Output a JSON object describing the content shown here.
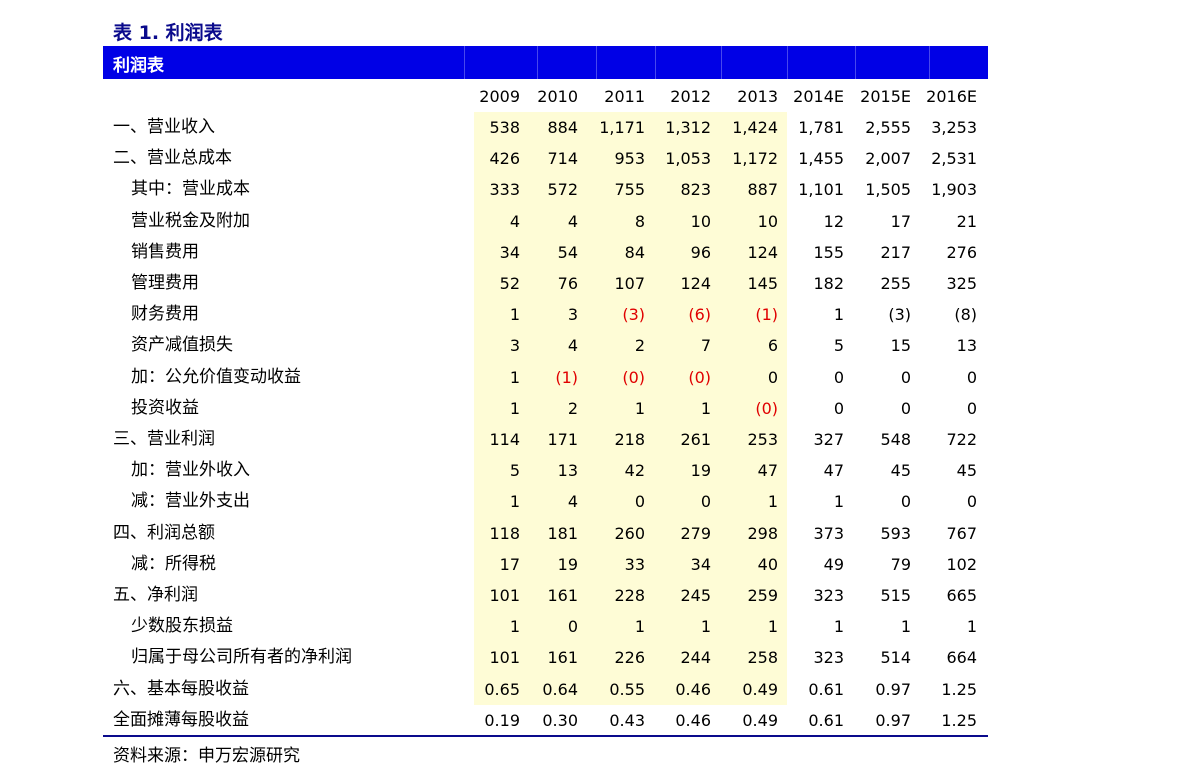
{
  "caption": "表 1. 利润表",
  "header": {
    "title": "利润表"
  },
  "years": [
    "2009",
    "2010",
    "2011",
    "2012",
    "2013",
    "2014E",
    "2015E",
    "2016E"
  ],
  "rows": [
    {
      "label": "一、营业收入",
      "indent": 0,
      "values": [
        "538",
        "884",
        "1,171",
        "1,312",
        "1,424",
        "1,781",
        "2,555",
        "3,253"
      ]
    },
    {
      "label": "二、营业总成本",
      "indent": 0,
      "values": [
        "426",
        "714",
        "953",
        "1,053",
        "1,172",
        "1,455",
        "2,007",
        "2,531"
      ]
    },
    {
      "label": "其中：营业成本",
      "indent": 1,
      "values": [
        "333",
        "572",
        "755",
        "823",
        "887",
        "1,101",
        "1,505",
        "1,903"
      ]
    },
    {
      "label": "营业税金及附加",
      "indent": 1,
      "values": [
        "4",
        "4",
        "8",
        "10",
        "10",
        "12",
        "17",
        "21"
      ]
    },
    {
      "label": "销售费用",
      "indent": 1,
      "values": [
        "34",
        "54",
        "84",
        "96",
        "124",
        "155",
        "217",
        "276"
      ]
    },
    {
      "label": "管理费用",
      "indent": 1,
      "values": [
        "52",
        "76",
        "107",
        "124",
        "145",
        "182",
        "255",
        "325"
      ]
    },
    {
      "label": "财务费用",
      "indent": 1,
      "values": [
        "1",
        "3",
        "(3)",
        "(6)",
        "(1)",
        "1",
        "(3)",
        "(8)"
      ],
      "neg": [
        false,
        false,
        true,
        true,
        true,
        false,
        false,
        false
      ]
    },
    {
      "label": "资产减值损失",
      "indent": 1,
      "values": [
        "3",
        "4",
        "2",
        "7",
        "6",
        "5",
        "15",
        "13"
      ]
    },
    {
      "label": "加：公允价值变动收益",
      "indent": 1,
      "values": [
        "1",
        "(1)",
        "(0)",
        "(0)",
        "0",
        "0",
        "0",
        "0"
      ],
      "neg": [
        false,
        true,
        true,
        true,
        false,
        false,
        false,
        false
      ]
    },
    {
      "label": "投资收益",
      "indent": 1,
      "values": [
        "1",
        "2",
        "1",
        "1",
        "(0)",
        "0",
        "0",
        "0"
      ],
      "neg": [
        false,
        false,
        false,
        false,
        true,
        false,
        false,
        false
      ]
    },
    {
      "label": "三、营业利润",
      "indent": 0,
      "values": [
        "114",
        "171",
        "218",
        "261",
        "253",
        "327",
        "548",
        "722"
      ]
    },
    {
      "label": "加：营业外收入",
      "indent": 1,
      "values": [
        "5",
        "13",
        "42",
        "19",
        "47",
        "47",
        "45",
        "45"
      ]
    },
    {
      "label": "减：营业外支出",
      "indent": 1,
      "values": [
        "1",
        "4",
        "0",
        "0",
        "1",
        "1",
        "0",
        "0"
      ]
    },
    {
      "label": "四、利润总额",
      "indent": 0,
      "values": [
        "118",
        "181",
        "260",
        "279",
        "298",
        "373",
        "593",
        "767"
      ]
    },
    {
      "label": "减：所得税",
      "indent": 1,
      "values": [
        "17",
        "19",
        "33",
        "34",
        "40",
        "49",
        "79",
        "102"
      ]
    },
    {
      "label": "五、净利润",
      "indent": 0,
      "values": [
        "101",
        "161",
        "228",
        "245",
        "259",
        "323",
        "515",
        "665"
      ]
    },
    {
      "label": "少数股东损益",
      "indent": 1,
      "values": [
        "1",
        "0",
        "1",
        "1",
        "1",
        "1",
        "1",
        "1"
      ]
    },
    {
      "label": "归属于母公司所有者的净利润",
      "indent": 1,
      "values": [
        "101",
        "161",
        "226",
        "244",
        "258",
        "323",
        "514",
        "664"
      ]
    },
    {
      "label": "六、基本每股收益",
      "indent": 0,
      "values": [
        "0.65",
        "0.64",
        "0.55",
        "0.46",
        "0.49",
        "0.61",
        "0.97",
        "1.25"
      ]
    },
    {
      "label": "全面摊薄每股收益",
      "indent": 0,
      "values": [
        "0.19",
        "0.30",
        "0.43",
        "0.46",
        "0.49",
        "0.61",
        "0.97",
        "1.25"
      ]
    }
  ],
  "source": "资料来源：申万宏源研究",
  "colors": {
    "header_bg": "#0000e6",
    "highlight": "#fefcd6",
    "negative": "#e00000",
    "caption": "#0a0a8c"
  }
}
